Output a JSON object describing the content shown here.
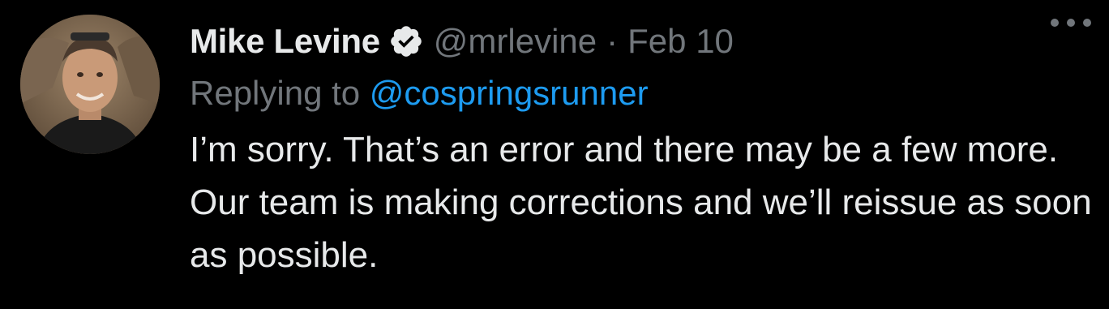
{
  "tweet": {
    "display_name": "Mike Levine",
    "handle": "@mrlevine",
    "separator": "·",
    "date": "Feb 10",
    "replying_prefix": "Replying to ",
    "replying_to": "@cospringsrunner",
    "text": "I’m sorry. That’s an error and there may be a few more. Our team is making corrections and we’ll reissue as soon as possible."
  },
  "icons": {
    "verified": "verified-badge-icon",
    "more": "more-options-icon"
  },
  "colors": {
    "background": "#000000",
    "primary_text": "#e7e9ea",
    "secondary_text": "#71767b",
    "link": "#1d9bf0"
  }
}
